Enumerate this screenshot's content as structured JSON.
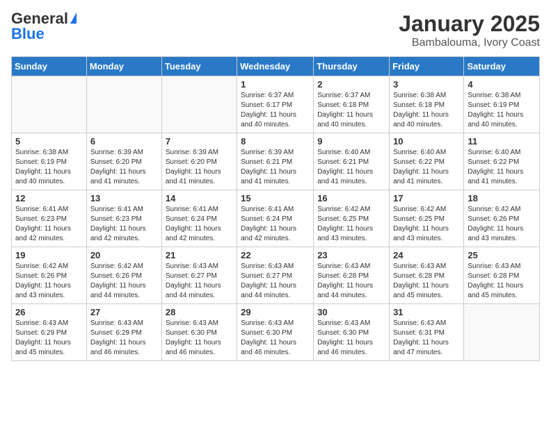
{
  "logo": {
    "general": "General",
    "blue": "Blue"
  },
  "title": "January 2025",
  "subtitle": "Bambalouma, Ivory Coast",
  "days_of_week": [
    "Sunday",
    "Monday",
    "Tuesday",
    "Wednesday",
    "Thursday",
    "Friday",
    "Saturday"
  ],
  "weeks": [
    [
      {
        "day": "",
        "info": ""
      },
      {
        "day": "",
        "info": ""
      },
      {
        "day": "",
        "info": ""
      },
      {
        "day": "1",
        "info": "Sunrise: 6:37 AM\nSunset: 6:17 PM\nDaylight: 11 hours and 40 minutes."
      },
      {
        "day": "2",
        "info": "Sunrise: 6:37 AM\nSunset: 6:18 PM\nDaylight: 11 hours and 40 minutes."
      },
      {
        "day": "3",
        "info": "Sunrise: 6:38 AM\nSunset: 6:18 PM\nDaylight: 11 hours and 40 minutes."
      },
      {
        "day": "4",
        "info": "Sunrise: 6:38 AM\nSunset: 6:19 PM\nDaylight: 11 hours and 40 minutes."
      }
    ],
    [
      {
        "day": "5",
        "info": "Sunrise: 6:38 AM\nSunset: 6:19 PM\nDaylight: 11 hours and 40 minutes."
      },
      {
        "day": "6",
        "info": "Sunrise: 6:39 AM\nSunset: 6:20 PM\nDaylight: 11 hours and 41 minutes."
      },
      {
        "day": "7",
        "info": "Sunrise: 6:39 AM\nSunset: 6:20 PM\nDaylight: 11 hours and 41 minutes."
      },
      {
        "day": "8",
        "info": "Sunrise: 6:39 AM\nSunset: 6:21 PM\nDaylight: 11 hours and 41 minutes."
      },
      {
        "day": "9",
        "info": "Sunrise: 6:40 AM\nSunset: 6:21 PM\nDaylight: 11 hours and 41 minutes."
      },
      {
        "day": "10",
        "info": "Sunrise: 6:40 AM\nSunset: 6:22 PM\nDaylight: 11 hours and 41 minutes."
      },
      {
        "day": "11",
        "info": "Sunrise: 6:40 AM\nSunset: 6:22 PM\nDaylight: 11 hours and 41 minutes."
      }
    ],
    [
      {
        "day": "12",
        "info": "Sunrise: 6:41 AM\nSunset: 6:23 PM\nDaylight: 11 hours and 42 minutes."
      },
      {
        "day": "13",
        "info": "Sunrise: 6:41 AM\nSunset: 6:23 PM\nDaylight: 11 hours and 42 minutes."
      },
      {
        "day": "14",
        "info": "Sunrise: 6:41 AM\nSunset: 6:24 PM\nDaylight: 11 hours and 42 minutes."
      },
      {
        "day": "15",
        "info": "Sunrise: 6:41 AM\nSunset: 6:24 PM\nDaylight: 11 hours and 42 minutes."
      },
      {
        "day": "16",
        "info": "Sunrise: 6:42 AM\nSunset: 6:25 PM\nDaylight: 11 hours and 43 minutes."
      },
      {
        "day": "17",
        "info": "Sunrise: 6:42 AM\nSunset: 6:25 PM\nDaylight: 11 hours and 43 minutes."
      },
      {
        "day": "18",
        "info": "Sunrise: 6:42 AM\nSunset: 6:26 PM\nDaylight: 11 hours and 43 minutes."
      }
    ],
    [
      {
        "day": "19",
        "info": "Sunrise: 6:42 AM\nSunset: 6:26 PM\nDaylight: 11 hours and 43 minutes."
      },
      {
        "day": "20",
        "info": "Sunrise: 6:42 AM\nSunset: 6:26 PM\nDaylight: 11 hours and 44 minutes."
      },
      {
        "day": "21",
        "info": "Sunrise: 6:43 AM\nSunset: 6:27 PM\nDaylight: 11 hours and 44 minutes."
      },
      {
        "day": "22",
        "info": "Sunrise: 6:43 AM\nSunset: 6:27 PM\nDaylight: 11 hours and 44 minutes."
      },
      {
        "day": "23",
        "info": "Sunrise: 6:43 AM\nSunset: 6:28 PM\nDaylight: 11 hours and 44 minutes."
      },
      {
        "day": "24",
        "info": "Sunrise: 6:43 AM\nSunset: 6:28 PM\nDaylight: 11 hours and 45 minutes."
      },
      {
        "day": "25",
        "info": "Sunrise: 6:43 AM\nSunset: 6:28 PM\nDaylight: 11 hours and 45 minutes."
      }
    ],
    [
      {
        "day": "26",
        "info": "Sunrise: 6:43 AM\nSunset: 6:29 PM\nDaylight: 11 hours and 45 minutes."
      },
      {
        "day": "27",
        "info": "Sunrise: 6:43 AM\nSunset: 6:29 PM\nDaylight: 11 hours and 46 minutes."
      },
      {
        "day": "28",
        "info": "Sunrise: 6:43 AM\nSunset: 6:30 PM\nDaylight: 11 hours and 46 minutes."
      },
      {
        "day": "29",
        "info": "Sunrise: 6:43 AM\nSunset: 6:30 PM\nDaylight: 11 hours and 46 minutes."
      },
      {
        "day": "30",
        "info": "Sunrise: 6:43 AM\nSunset: 6:30 PM\nDaylight: 11 hours and 46 minutes."
      },
      {
        "day": "31",
        "info": "Sunrise: 6:43 AM\nSunset: 6:31 PM\nDaylight: 11 hours and 47 minutes."
      },
      {
        "day": "",
        "info": ""
      }
    ]
  ]
}
